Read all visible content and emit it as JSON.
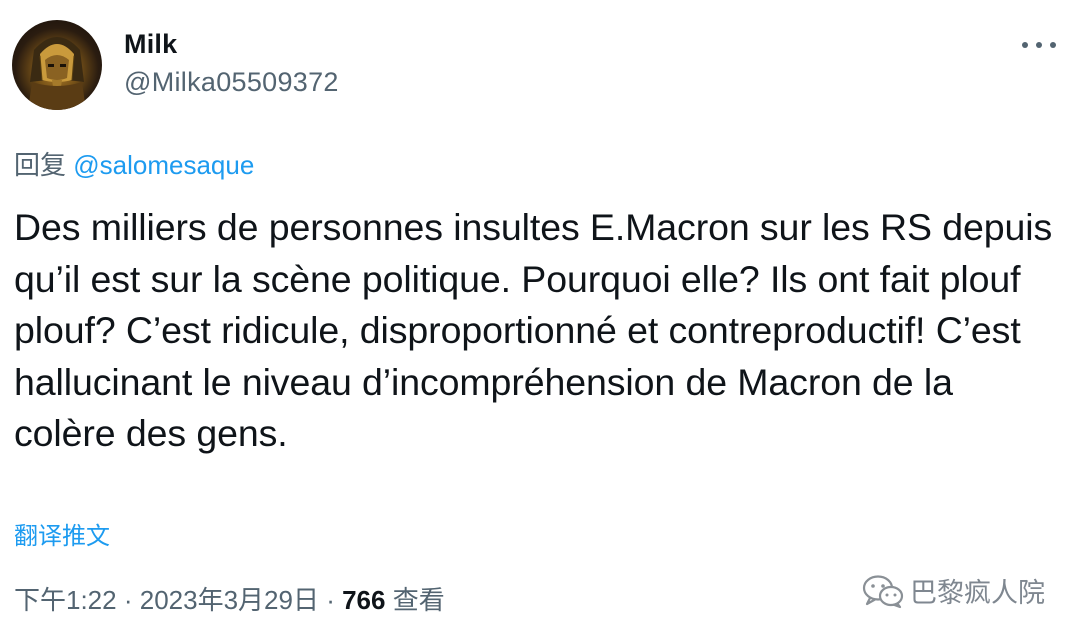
{
  "tweet": {
    "author": {
      "name": "Milk",
      "handle": "@Milka05509372"
    },
    "replying_to": {
      "prefix": "回复",
      "handle": "@salomesaque"
    },
    "text": "Des milliers de personnes insultes E.Macron sur les RS depuis qu’il est sur la scène politique. Pourquoi elle? Ils ont fait plouf plouf? C’est ridicule, disproportionné et contreproductif! C’est hallucinant le niveau d’incompréhension de Macron de la colère des gens.",
    "translate_label": "翻译推文",
    "meta": {
      "time": "下午1:22",
      "date": "2023年3月29日",
      "views_count": "766",
      "views_label": "查看",
      "separator": "·"
    }
  },
  "watermark": {
    "text": "巴黎疯人院",
    "icon": "wechat-icon"
  },
  "icons": {
    "more": "more-dots-icon",
    "avatar": "avatar-image"
  },
  "colors": {
    "primary_text": "#0f1419",
    "secondary_text": "#536471",
    "link": "#1d9bf0",
    "watermark": "#7f8790"
  }
}
